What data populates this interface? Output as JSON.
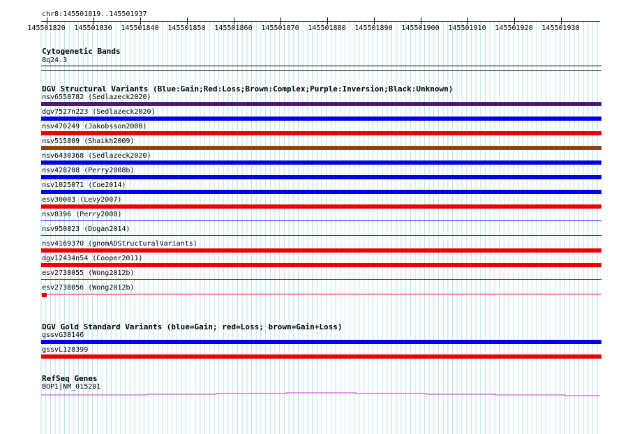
{
  "ruler": {
    "locus": "chr8:145501819..145501937",
    "ticks": [
      "145501820",
      "145501830",
      "145501840",
      "145501850",
      "145501860",
      "145501870",
      "145501880",
      "145501890",
      "145501900",
      "145501910",
      "145501920",
      "145501930"
    ]
  },
  "cytoband": {
    "title": "Cytogenetic Bands",
    "band": "8q24.3"
  },
  "dgv": {
    "title": "DGV Structural Variants (Blue:Gain;Red:Loss;Brown:Complex;Purple:Inversion;Black:Unknown)",
    "legend": {
      "gain": "#0000e6",
      "loss": "#ee0000",
      "complex": "#8b4513",
      "inversion": "#4b1a7a",
      "unknown": "#000000"
    },
    "items": [
      {
        "label": "nsv6558782 (Sedlazeck2020)",
        "type": "inversion"
      },
      {
        "label": "dgv7527n223 (Sedlazeck2020)",
        "type": "gain"
      },
      {
        "label": "nsv470249 (Jakobsson2008)",
        "type": "loss"
      },
      {
        "label": "nsv515809 (Shaikh2009)",
        "type": "complex"
      },
      {
        "label": "nsv6430368 (Sedlazeck2020)",
        "type": "gain"
      },
      {
        "label": "nsv428208 (Perry2008b)",
        "type": "gain"
      },
      {
        "label": "nsv1025071 (Coe2014)",
        "type": "gain"
      },
      {
        "label": "esv30003 (Levy2007)",
        "type": "loss"
      },
      {
        "label": "nsv8396 (Perry2008)",
        "type": "gain-thin"
      },
      {
        "label": "nsv950823 (Dogan2014)",
        "type": "loss-thin"
      },
      {
        "label": "nsv4169370 (gnomADStructuralVariants)",
        "type": "loss"
      },
      {
        "label": "dgv12434n54 (Cooper2011)",
        "type": "loss"
      },
      {
        "label": "esv2738055 (Wong2012b)",
        "type": "loss-thin"
      },
      {
        "label": "esv2738056 (Wong2012b)",
        "type": "loss-thin"
      }
    ]
  },
  "gold": {
    "title": "DGV Gold Standard Variants (blue=Gain; red=Loss; brown=Gain+Loss)",
    "items": [
      {
        "label": "gssvG38146",
        "type": "gain"
      },
      {
        "label": "gssvL128399",
        "type": "loss"
      }
    ]
  },
  "refseq": {
    "title": "RefSeq Genes",
    "gene": "BOP1|NM_015201",
    "color": "#cc33cc"
  }
}
